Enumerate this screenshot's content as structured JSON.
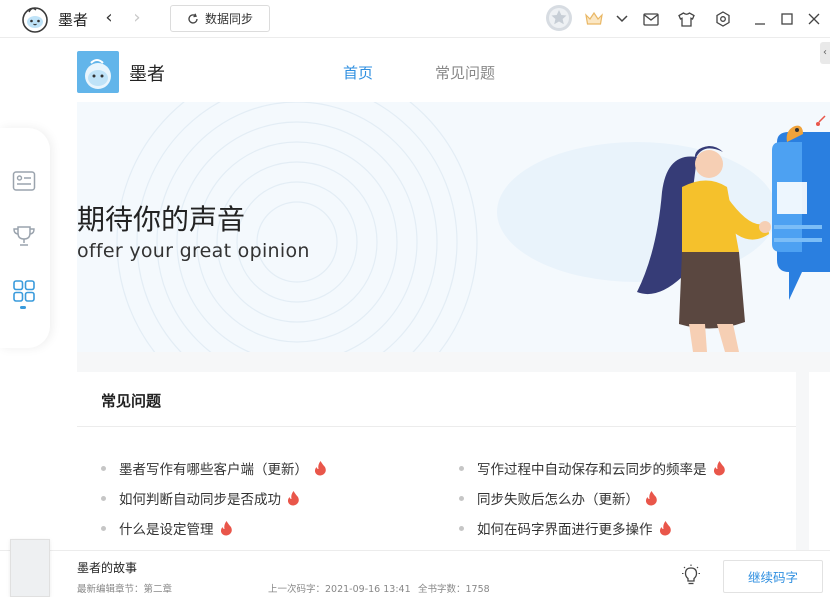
{
  "titlebar": {
    "app_name": "墨者",
    "sync_label": "数据同步"
  },
  "header": {
    "brand_name": "墨者",
    "tabs": [
      {
        "label": "首页",
        "active": true
      },
      {
        "label": "常见问题",
        "active": false
      }
    ]
  },
  "banner": {
    "title": "期待你的声音",
    "subtitle": "offer your great opinion"
  },
  "faq": {
    "heading": "常见问题",
    "left_items": [
      "墨者写作有哪些客户端（更新）",
      "如何判断自动同步是否成功",
      "什么是设定管理"
    ],
    "right_items": [
      "写作过程中自动保存和云同步的频率是",
      "同步失败后怎么办（更新）",
      "如何在码字界面进行更多操作"
    ]
  },
  "bottom": {
    "book_title": "墨者的故事",
    "latest_chapter": "最新编辑章节：第二章",
    "last_typing": "上一次码字：2021-09-16 13:41",
    "word_count": "全书字数：1758",
    "continue_label": "继续码字"
  },
  "colors": {
    "accent": "#2f8fe0",
    "fire": "#e9564a",
    "logo_blue": "#62b5ea"
  }
}
